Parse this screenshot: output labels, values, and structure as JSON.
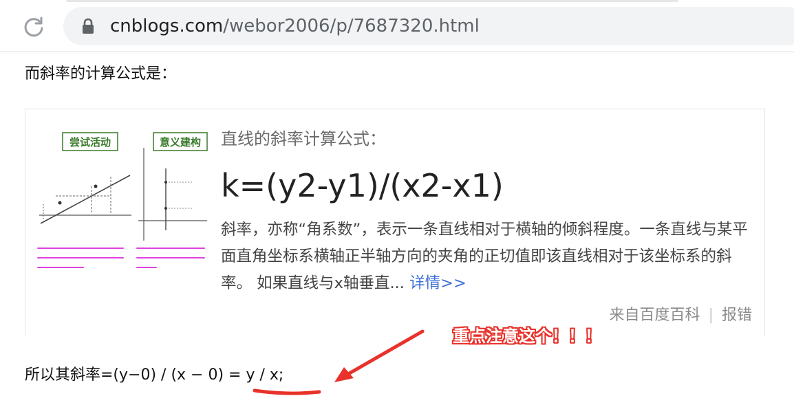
{
  "browser": {
    "url_domain": "cnblogs.com",
    "url_path": "/webor2006/p/7687320.html",
    "reload_icon": "reload-icon",
    "lock_icon": "lock-icon"
  },
  "content": {
    "intro_text": "而斜率的计算公式是：",
    "card": {
      "figure_labels": [
        "尝试活动",
        "意义建构"
      ],
      "title": "直线的斜率计算公式：",
      "formula": "k=(y2-y1)/(x2-x1)",
      "description": "斜率，亦称“角系数”，表示一条直线相对于横轴的倾斜程度。一条直线与某平面直角坐标系横轴正半轴方向的夹角的正切值即该直线相对于该坐标系的斜率。 如果直线与x轴垂直...",
      "more_link": "详情>>",
      "source": "来自百度百科",
      "report": "报错"
    },
    "annotation": "重点注意这个！！！",
    "slope_text": "所以其斜率=(y−0) / (x − 0) = y / x;"
  },
  "colors": {
    "annotation_red": "#e8322b",
    "link_blue": "#3b6fd6",
    "figure_green": "#3a7a2a",
    "figure_magenta": "#e040e0"
  }
}
